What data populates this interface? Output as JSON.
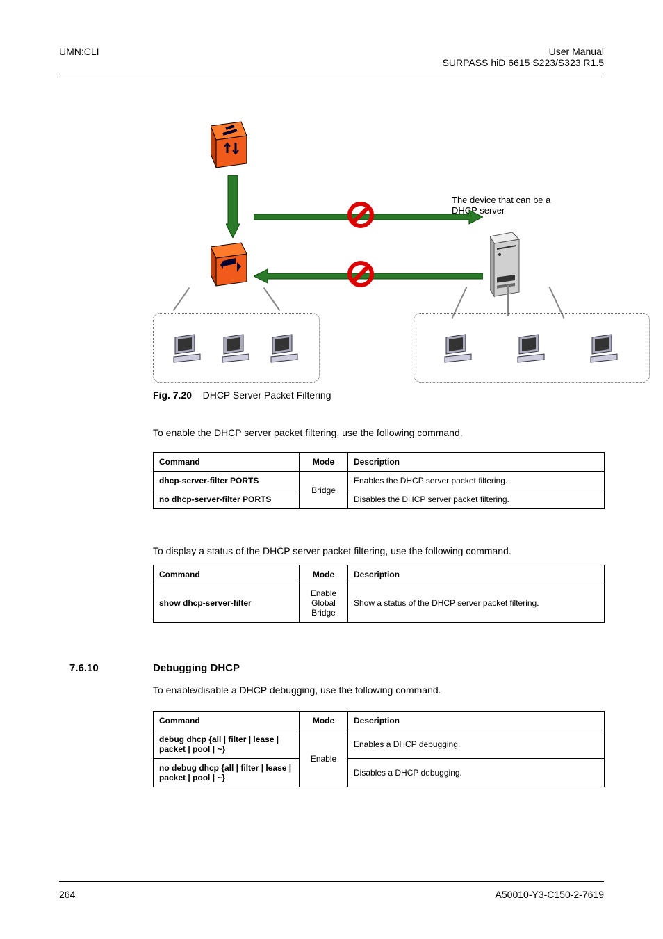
{
  "header": {
    "left": "UMN:CLI",
    "right_line1": "User Manual",
    "right_line2": "SURPASS hiD 6615 S223/S323 R1.5"
  },
  "diagram": {
    "server_label_l1": "The device that can be a",
    "server_label_l2": "DHCP server"
  },
  "figure": {
    "label": "Fig. 7.20",
    "caption": "DHCP Server Packet Filtering"
  },
  "para1": "To enable the DHCP server packet filtering, use the following command.",
  "table1": {
    "h1": "Command",
    "h2": "Mode",
    "h3": "Description",
    "r1c1": "dhcp-server-filter PORTS",
    "mode": "Bridge",
    "r1c3": "Enables the DHCP server packet filtering.",
    "r2c1": "no dhcp-server-filter PORTS",
    "r2c3": "Disables the DHCP server packet filtering."
  },
  "para2": "To display a status of the DHCP server packet filtering, use the following command.",
  "table2": {
    "h1": "Command",
    "h2": "Mode",
    "h3": "Description",
    "r1c1": "show dhcp-server-filter",
    "mode_l1": "Enable",
    "mode_l2": "Global",
    "mode_l3": "Bridge",
    "r1c3": "Show a status of the DHCP server packet filtering."
  },
  "section": {
    "num": "7.6.10",
    "title": "Debugging DHCP"
  },
  "para3": "To enable/disable a DHCP debugging, use the following command.",
  "table3": {
    "h1": "Command",
    "h2": "Mode",
    "h3": "Description",
    "r1c1": "debug dhcp {all | filter | lease | packet | pool | ~}",
    "mode": "Enable",
    "r1c3": "Enables a DHCP debugging.",
    "r2c1": "no debug dhcp {all | filter | lease | packet | pool | ~}",
    "r2c3": "Disables a DHCP debugging."
  },
  "footer": {
    "page": "264",
    "doc_id": "A50010-Y3-C150-2-7619"
  }
}
